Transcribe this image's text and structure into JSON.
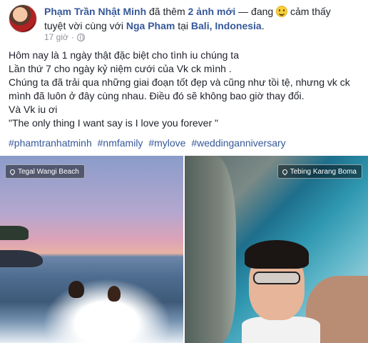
{
  "header": {
    "author": "Phạm Trần Nhật Minh",
    "action_pre": " đã thêm ",
    "photos_count": "2 ảnh mới",
    "action_mid": " — đang ",
    "feeling": " cảm thấy",
    "feeling2": "tuyệt vời cùng với ",
    "tagged": "Nga Pham",
    "at": " tại ",
    "location": "Bali, Indonesia",
    "period": ".",
    "time": "17 giờ",
    "separator": "·"
  },
  "body": {
    "lines": [
      "Hôm nay là 1 ngày thật đặc biệt cho tình iu chúng ta",
      "Lần thứ 7 cho ngày kỷ niệm cưới của Vk ck mình .",
      "Chúng ta đã trải qua những giai đoạn tốt đẹp và cũng như tồi tệ, nhưng vk ck mình đã luôn ở đây cùng nhau. Điều đó sẽ không bao giờ thay đổi.",
      "Và Vk iu ơi",
      "\"The only thing I want say is I love you forever \""
    ]
  },
  "hashtags": [
    "#phamtranhatminh",
    "#nmfamily",
    "#mylove",
    "#weddinganniversary"
  ],
  "photos": [
    {
      "location": "Tegal Wangi Beach",
      "icon": "pin-icon"
    },
    {
      "location": "Tebing Karang Boma",
      "icon": "pin-icon"
    }
  ]
}
